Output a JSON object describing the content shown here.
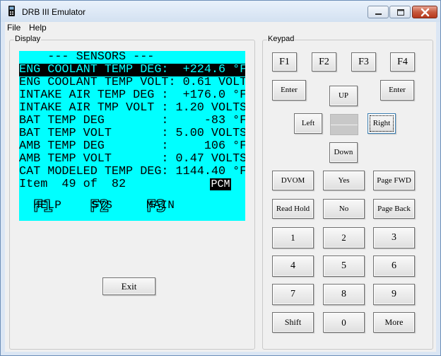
{
  "window": {
    "title": "DRB III Emulator"
  },
  "menu": [
    "File",
    "Help"
  ],
  "display": {
    "group_label": "Display",
    "lines": [
      "    --- SENSORS ---",
      "ENG COOLANT TEMP DEG:  +224.6 °F",
      "ENG COOLANT TEMP VOLT: 0.61 VOLT",
      "INTAKE AIR TEMP DEG :  +176.0 °F",
      "INTAKE AIR TMP VOLT : 1.20 VOLTS",
      "BAT TEMP DEG        :     -83 °F",
      "BAT TEMP VOLT       : 5.00 VOLTS",
      "AMB TEMP DEG        :     106 °F",
      "AMB TEMP VOLT       : 0.47 VOLTS",
      "CAT MODELED TEMP DEG: 1144.40 °F",
      "Item  49 of  82"
    ],
    "badge": "PCM",
    "fkeys": [
      {
        "num": "F1",
        "label": "HELP"
      },
      {
        "num": "F2",
        "label": "SYS"
      },
      {
        "num": "F3",
        "label": "MAIN"
      }
    ]
  },
  "exit_label": "Exit",
  "keypad": {
    "group_label": "Keypad",
    "f_keys": [
      "F1",
      "F2",
      "F3",
      "F4"
    ],
    "enter_left": "Enter",
    "enter_right": "Enter",
    "up": "UP",
    "left": "Left",
    "right": "Right",
    "down": "Down",
    "func": [
      "DVOM",
      "Yes",
      "Page FWD",
      "Read Hold",
      "No",
      "Page Back"
    ],
    "numbers": [
      "1",
      "2",
      "3",
      "4",
      "5",
      "6",
      "7",
      "8",
      "9",
      "Shift",
      "0",
      "More"
    ]
  }
}
